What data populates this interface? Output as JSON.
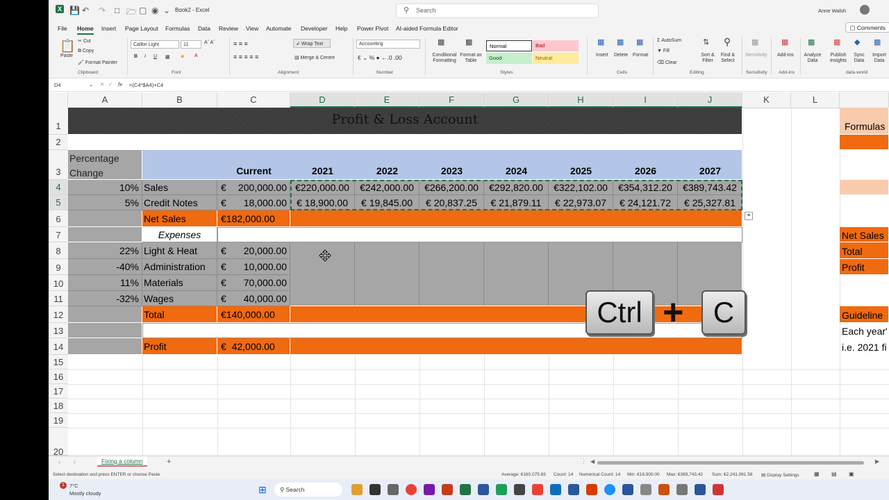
{
  "window": {
    "file_name": "Book2",
    "app_name": "Excel",
    "title": "Book2 - Excel",
    "search_placeholder": "Search",
    "user_name": "Anne Walsh"
  },
  "menu": {
    "tabs": [
      "File",
      "Home",
      "Insert",
      "Page Layout",
      "Formulas",
      "Data",
      "Review",
      "View",
      "Automate",
      "Developer",
      "Help",
      "Power Pivot",
      "AI-aided Formula Editor"
    ],
    "active": "Home",
    "comments": "Comments"
  },
  "ribbon": {
    "clipboard": {
      "paste": "Paste",
      "cut": "Cut",
      "copy": "Copy",
      "format_painter": "Format Painter",
      "group": "Clipboard"
    },
    "font": {
      "name": "Calibri Light",
      "size": "11",
      "group": "Font"
    },
    "alignment": {
      "wrap": "Wrap Text",
      "merge": "Merge & Centre",
      "group": "Alignment"
    },
    "number": {
      "format": "Accounting",
      "group": "Number"
    },
    "styles": {
      "conditional": "Conditional Formatting",
      "format_table": "Format as Table",
      "normal": "Normal",
      "bad": "Bad",
      "good": "Good",
      "neutral": "Neutral",
      "group": "Styles"
    },
    "cells": {
      "insert": "Insert",
      "delete": "Delete",
      "format": "Format",
      "group": "Cells"
    },
    "editing": {
      "autosum": "AutoSum",
      "fill": "Fill",
      "clear": "Clear",
      "sort": "Sort & Filter",
      "find": "Find & Select",
      "group": "Editing"
    },
    "sensitivity": {
      "label": "Sensitivity",
      "group": "Sensitivity"
    },
    "addins": {
      "label": "Add-ins",
      "group": "Add-ins"
    },
    "analyze": "Analyze Data",
    "publish": "Publish Insights",
    "sync": "Sync Data",
    "import": "Import Data",
    "dataworld": "data.world"
  },
  "formula_bar": {
    "name_box": "D4",
    "formula": "=(C4*$A4)+C4"
  },
  "columns": [
    "A",
    "B",
    "C",
    "D",
    "E",
    "F",
    "G",
    "H",
    "I",
    "J",
    "K",
    "L"
  ],
  "rows": [
    "1",
    "2",
    "3",
    "4",
    "5",
    "6",
    "7",
    "8",
    "9",
    "10",
    "11",
    "12",
    "13",
    "14",
    "15",
    "16",
    "17",
    "18",
    "19",
    "20"
  ],
  "sheet": {
    "title": "Profit & Loss Account",
    "pct_header": "Percentage Change",
    "current_header": "Current",
    "years": [
      "2021",
      "2022",
      "2023",
      "2024",
      "2025",
      "2026",
      "2027"
    ],
    "currency_symbol": "€",
    "sales": {
      "pct": "10%",
      "label": "Sales",
      "current": "200,000.00",
      "projections": [
        "€220,000.00",
        "€242,000.00",
        "€266,200.00",
        "€292,820.00",
        "€322,102.00",
        "€354,312.20",
        "€389,743.42"
      ]
    },
    "credit_notes": {
      "pct": "5%",
      "label": "Credit Notes",
      "current": "18,000.00",
      "projections": [
        "€ 18,900.00",
        "€ 19,845.00",
        "€ 20,837.25",
        "€ 21,879.11",
        "€ 22,973.07",
        "€ 24,121.72",
        "€ 25,327.81"
      ]
    },
    "net_sales": {
      "label": "Net Sales",
      "current": "€182,000.00"
    },
    "expenses_label": "Expenses",
    "expenses": [
      {
        "pct": "22%",
        "label": "Light & Heat",
        "current": "20,000.00"
      },
      {
        "pct": "-40%",
        "label": "Administration",
        "current": "10,000.00"
      },
      {
        "pct": "11%",
        "label": "Materials",
        "current": "70,000.00"
      },
      {
        "pct": "-32%",
        "label": "Wages",
        "current": "40,000.00"
      }
    ],
    "total": {
      "label": "Total",
      "current": "€140,000.00"
    },
    "profit": {
      "label": "Profit",
      "current": "€  42,000.00"
    },
    "side_panel": {
      "formulas": "Formulas",
      "net_sales": "Net Sales",
      "total": "Total",
      "profit": "Profit",
      "guideline": "Guideline",
      "each_year": "Each year'",
      "ie": "i.e. 2021 fi"
    }
  },
  "keys": {
    "ctrl": "Ctrl",
    "plus": "+",
    "c": "C"
  },
  "sheet_tab": {
    "name": "Fixing a column",
    "add": "+"
  },
  "status": {
    "message": "Select destination and press ENTER or choose Paste",
    "average": "Average: €160,075.83",
    "count": "Count: 14",
    "numerical_count": "Numerical Count: 14",
    "min": "Min: €18,900.00",
    "max": "Max: €389,743.42",
    "sum": "Sum: €2,241,061.58",
    "display_settings": "Display Settings"
  },
  "taskbar": {
    "weather_temp": "7°C",
    "weather_desc": "Mostly cloudy",
    "search": "Search"
  },
  "colors": {
    "orange": "#f06a0f",
    "gray": "#a6a6a6",
    "blue_header": "#b4c6e7",
    "title_bg": "#3a3a3a",
    "excel_green": "#217346"
  }
}
